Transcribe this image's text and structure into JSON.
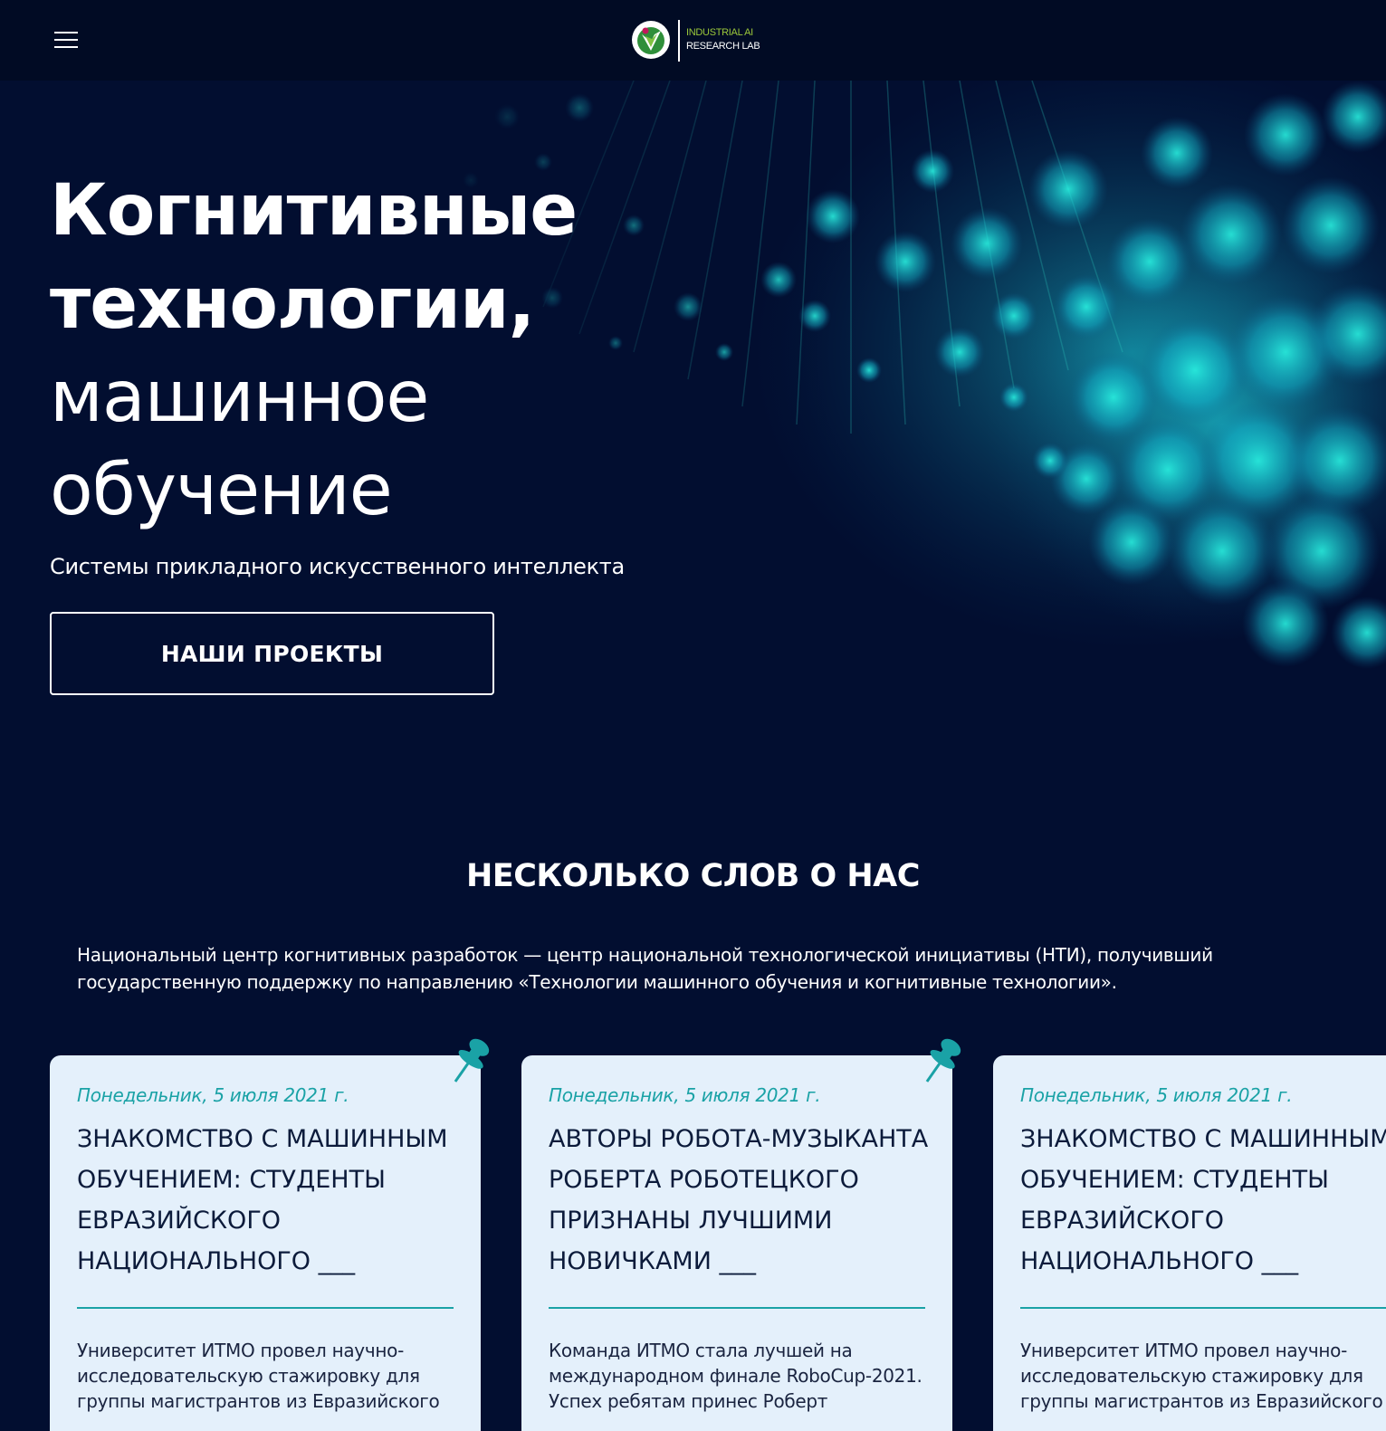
{
  "header": {
    "menu_icon": "hamburger-menu-icon",
    "logo": {
      "line1": "INDUSTRIAL AI",
      "line2": "RESEARCH LAB"
    }
  },
  "hero": {
    "title_bold_1": "Когнитивные",
    "title_bold_2": "технологии,",
    "title_light_1": "машинное",
    "title_light_2": "обучение",
    "subtitle": "Системы прикладного искусственного интеллекта",
    "cta_label": "НАШИ ПРОЕКТЫ"
  },
  "about": {
    "title": "НЕСКОЛЬКО СЛОВ О НАС",
    "text": "Национальный центр когнитивных разработок — центр национальной технологической инициативы (НТИ), получивший государственную поддержку по направлению «Технологии машинного обучения и когнитивные технологии»."
  },
  "news": [
    {
      "date": "Понедельник, 5 июля 2021 г.",
      "title": "ЗНАКОМСТВО С МАШИННЫМ ОБУЧЕНИЕМ: СТУДЕНТЫ ЕВРАЗИЙСКОГО НАЦИОНАЛЬНОГО ___",
      "text": "Университет ИТМО провел научно-исследовательскую стажировку для группы магистрантов из Евразийского",
      "pinned": true
    },
    {
      "date": "Понедельник, 5 июля 2021 г.",
      "title": "АВТОРЫ РОБОТА-МУЗЫКАНТА РОБЕРТА РОБОТЕЦКОГО ПРИЗНАНЫ ЛУЧШИМИ НОВИЧКАМИ ___",
      "text": "Команда ИТМО стала лучшей на международном финале RoboCup-2021. Успех ребятам принес Роберт",
      "pinned": true
    },
    {
      "date": "Понедельник, 5 июля 2021 г.",
      "title": "ЗНАКОМСТВО С МАШИННЫМ ОБУЧЕНИЕМ: СТУДЕНТЫ ЕВРАЗИЙСКОГО НАЦИОНАЛЬНОГО ___",
      "text": "Университет ИТМО провел научно-исследовательскую стажировку для группы магистрантов из Евразийского",
      "pinned": false
    }
  ],
  "colors": {
    "background": "#020e30",
    "header": "#010b24",
    "accent_teal": "#1aa2a6",
    "card_bg": "#e4f0fb",
    "logo_green": "#9bc83a"
  }
}
